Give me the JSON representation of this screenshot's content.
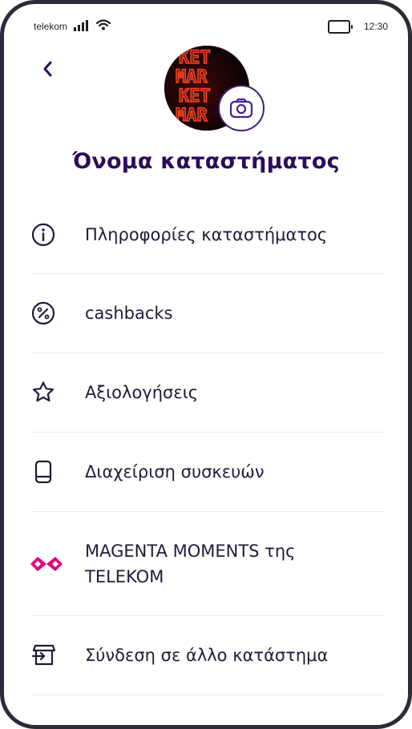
{
  "status_bar": {
    "carrier": "telekom",
    "time": "12:30"
  },
  "header": {
    "store_name": "Όνομα καταστήματος"
  },
  "menu": {
    "items": [
      {
        "label": "Πληροφορίες καταστήματος",
        "icon": "info-icon"
      },
      {
        "label": "cashbacks",
        "icon": "percent-icon"
      },
      {
        "label": "Αξιολογήσεις",
        "icon": "star-icon"
      },
      {
        "label": "Διαχείριση συσκευών",
        "icon": "device-icon"
      },
      {
        "label": "MAGENTA MOMENTS της TELEKOM",
        "icon": "magenta-moments-logo"
      },
      {
        "label": "Σύνδεση σε άλλο κατάστημα",
        "icon": "switch-store-icon"
      }
    ]
  },
  "colors": {
    "primary": "#2c0c5c",
    "text": "#1e1b3a",
    "divider": "#ebebf0",
    "magenta": "#e2007a"
  }
}
